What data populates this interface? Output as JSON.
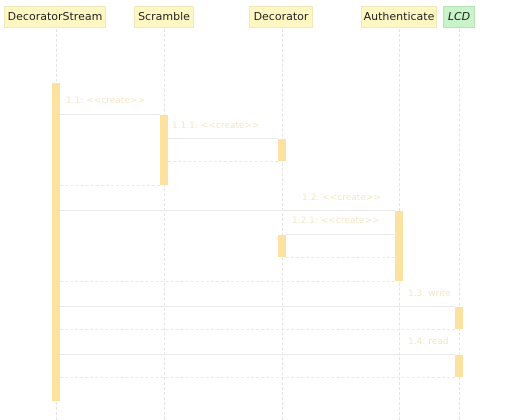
{
  "participants": [
    {
      "name": "DecoratorStream"
    },
    {
      "name": "Scramble"
    },
    {
      "name": "Decorator"
    },
    {
      "name": "Authenticate"
    },
    {
      "name": "LCD"
    }
  ],
  "messages": [
    {
      "label": "1.1: <<create>>"
    },
    {
      "label": "1.1.1: <<create>>"
    },
    {
      "label": "1.2: <<create>>"
    },
    {
      "label": "1.2.1: <<create>>"
    },
    {
      "label": "1.3: write"
    },
    {
      "label": "1.4: read"
    }
  ]
}
